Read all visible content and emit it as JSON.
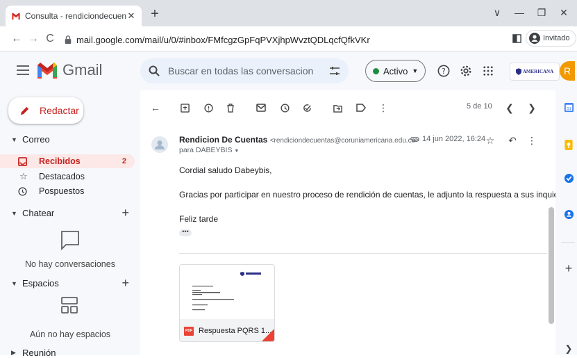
{
  "browser": {
    "tab_title": "Consulta - rendiciondecuentas@",
    "tab_close": "✕",
    "new_tab": "+",
    "window_controls": {
      "collapse": "∨",
      "minimize": "—",
      "restore": "❐",
      "close": "✕"
    },
    "url": "mail.google.com/mail/u/0/#inbox/FMfcgzGpFqPVXjhpWvztQDLqcfQfkVKr",
    "profile_label": "Invitado"
  },
  "gmail": {
    "product_name": "Gmail",
    "search_placeholder": "Buscar en todas las conversacion",
    "status_label": "Activo",
    "org_logo_text": "AMERICANA",
    "avatar_letter": "R"
  },
  "sidebar": {
    "compose_label": "Redactar",
    "sections": {
      "mail": "Correo",
      "chat": "Chatear",
      "spaces": "Espacios",
      "meet": "Reunión"
    },
    "mail_items": [
      {
        "label": "Recibidos",
        "count": "2"
      },
      {
        "label": "Destacados"
      },
      {
        "label": "Pospuestos"
      }
    ],
    "chat_empty": "No hay conversaciones",
    "spaces_empty": "Aún no hay espacios"
  },
  "toolbar": {
    "pager": "5 de 10"
  },
  "message": {
    "sender_name": "Rendicion De Cuentas",
    "sender_email": "<rendiciondecuentas@coruniamericana.edu.co>",
    "date": "14 jun 2022, 16:24",
    "recipient": "para DABEYBIS",
    "greeting": "Cordial saludo Dabeybis,",
    "body": "Gracias por participar en nuestro proceso de rendición de cuentas, le adjunto la respuesta a sus inquietudes.",
    "closing": "Feliz tarde",
    "more": "•••",
    "attachment_name": "Respuesta PQRS 1...",
    "attachment_type": "PDF"
  },
  "colors": {
    "gmail_red": "#c5221f",
    "active_green": "#1e8e3e",
    "avatar_orange": "#f29900",
    "org_blue": "#2b2f86"
  }
}
